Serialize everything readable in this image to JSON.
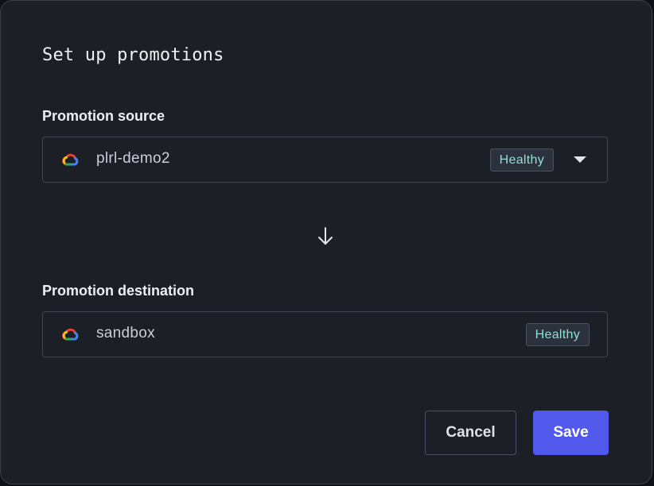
{
  "dialog": {
    "title": "Set up promotions"
  },
  "source": {
    "label": "Promotion source",
    "cluster": "plrl-demo2",
    "status": "Healthy",
    "icon": "google-cloud-icon"
  },
  "destination": {
    "label": "Promotion destination",
    "cluster": "sandbox",
    "status": "Healthy",
    "icon": "google-cloud-icon"
  },
  "flow_icon": "arrow-down-icon",
  "actions": {
    "cancel_label": "Cancel",
    "save_label": "Save"
  },
  "colors": {
    "background": "#1c1f26",
    "accent": "#5158ec",
    "healthy_text": "#8fe0cf",
    "border": "#3f4553"
  }
}
